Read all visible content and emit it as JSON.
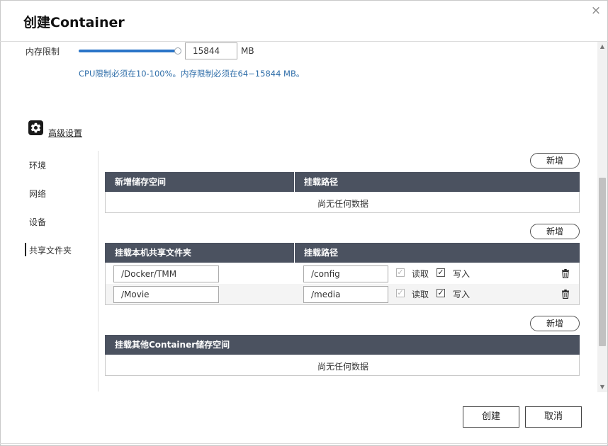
{
  "dialog": {
    "title": "创建Container",
    "close_glyph": "×"
  },
  "resources": {
    "memory_label": "内存限制",
    "memory_value": "15844",
    "memory_unit": "MB",
    "memory_slider_fraction": 0.98,
    "hint": "CPU限制必须在10-100%。内存限制必须在64−15844 MB。"
  },
  "advanced": {
    "icon": "gear-icon",
    "label": "高级设置"
  },
  "nav": {
    "items": [
      {
        "label": "环境"
      },
      {
        "label": "网络"
      },
      {
        "label": "设备"
      },
      {
        "label": "共享文件夹",
        "active": true
      }
    ]
  },
  "sections": {
    "storage": {
      "add_label": "新增",
      "col1": "新增储存空间",
      "col2": "挂载路径",
      "empty_text": "尚无任何数据"
    },
    "shared_folders": {
      "add_label": "新增",
      "col1": "挂载本机共享文件夹",
      "col2": "挂载路径",
      "rows": [
        {
          "host_path": "/Docker/TMM",
          "mount_path": "/config",
          "read_label": "读取",
          "write_label": "写入",
          "read_checked": true,
          "write_checked": true
        },
        {
          "host_path": "/Movie",
          "mount_path": "/media",
          "read_label": "读取",
          "write_label": "写入",
          "read_checked": true,
          "write_checked": true
        }
      ]
    },
    "container_storage": {
      "add_label": "新增",
      "col1": "挂载其他Container储存空间",
      "empty_text": "尚无任何数据"
    }
  },
  "footer": {
    "create_label": "创建",
    "cancel_label": "取消"
  },
  "colors": {
    "accent": "#2a75c8",
    "hint_text": "#2f6ea9",
    "table_header": "#4b5260",
    "alt_row": "#f4f4f4"
  }
}
